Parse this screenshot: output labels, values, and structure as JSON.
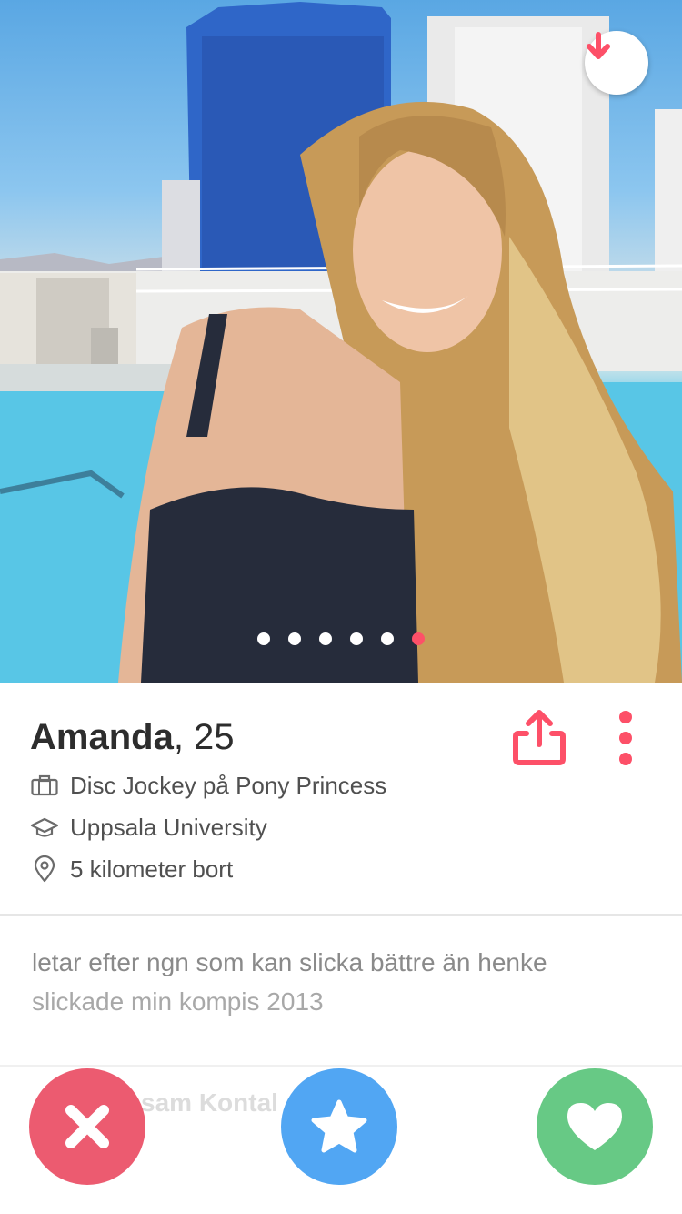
{
  "photo": {
    "alt": "profile photo",
    "photo_count": 6,
    "active_index": 5
  },
  "profile": {
    "name": "Amanda",
    "age_text": ", 25",
    "job": "Disc Jockey på Pony Princess",
    "school": "Uppsala University",
    "distance": "5 kilometer bort"
  },
  "bio": {
    "line1": "letar efter ngn som kan slicka bättre än henke",
    "line2": "slickade min kompis 2013"
  },
  "faded_section_label": "sam Kontal",
  "icons": {
    "download": "arrow-down-icon",
    "share": "share-icon",
    "more": "more-vertical-icon",
    "job": "briefcase-icon",
    "school": "graduation-cap-icon",
    "location": "location-pin-icon",
    "nope": "close-icon",
    "super": "star-icon",
    "like": "heart-icon"
  },
  "colors": {
    "accent": "#fd5068",
    "nope": "#ec5b70",
    "super": "#51a6f3",
    "like": "#67c985",
    "text": "#2d2d2d",
    "muted": "#8a8a8a"
  }
}
